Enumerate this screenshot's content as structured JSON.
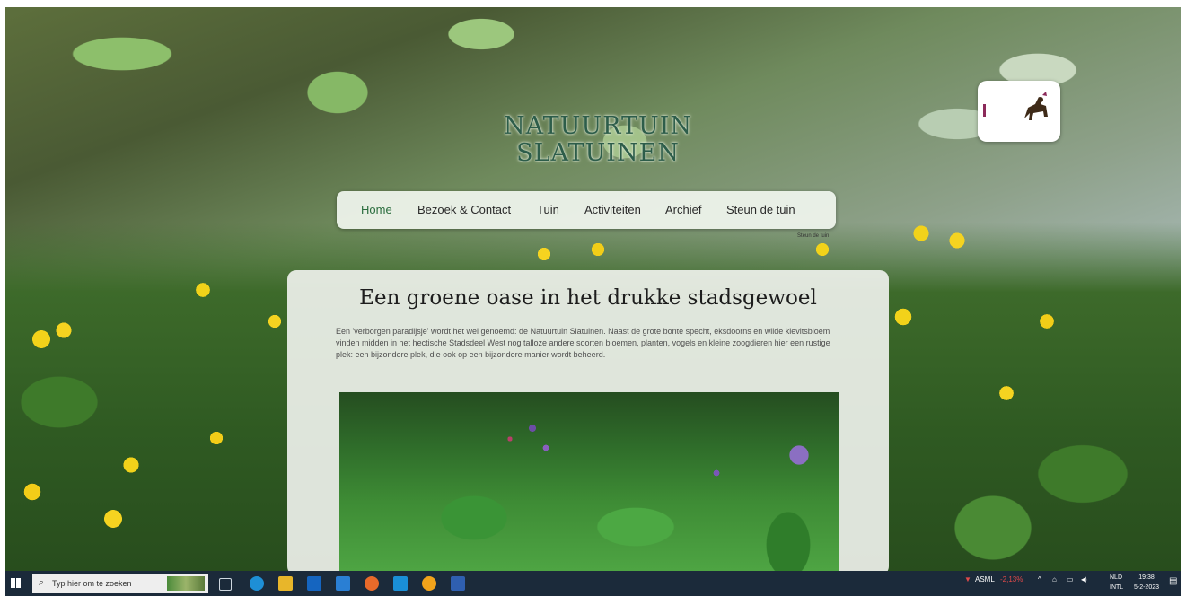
{
  "site": {
    "title_line1": "Natuurtuin",
    "title_line2": "Slatuinen"
  },
  "nav": {
    "items": [
      {
        "label": "Home",
        "active": true
      },
      {
        "label": "Bezoek & Contact"
      },
      {
        "label": "Tuin"
      },
      {
        "label": "Activiteiten"
      },
      {
        "label": "Archief"
      },
      {
        "label": "Steun de tuin"
      }
    ],
    "tooltip": "Steun de tuin"
  },
  "main": {
    "heading": "Een groene oase in het drukke stadsgewoel",
    "intro": "Een 'verborgen paradijsje' wordt het wel genoemd: de Natuurtuin Slatuinen. Naast de grote bonte specht, eksdoorns en wilde kievitsbloem vinden midden in het hectische Stadsdeel West nog talloze andere soorten bloemen, planten, vogels en kleine zoogdieren hier een rustige plek: een bijzondere plek, die ook op een bijzondere manier wordt beheerd."
  },
  "taskbar": {
    "search_placeholder": "Typ hier om te zoeken",
    "stock_name": "ASML",
    "stock_change": "-2,13%",
    "lang_line1": "NLD",
    "lang_line2": "INTL",
    "time": "19:38",
    "date": "5-2-2023"
  },
  "colors": {
    "accent_green": "#2b6d3f",
    "taskbar": "#1b2a3a",
    "stock_down": "#e04a4a"
  }
}
